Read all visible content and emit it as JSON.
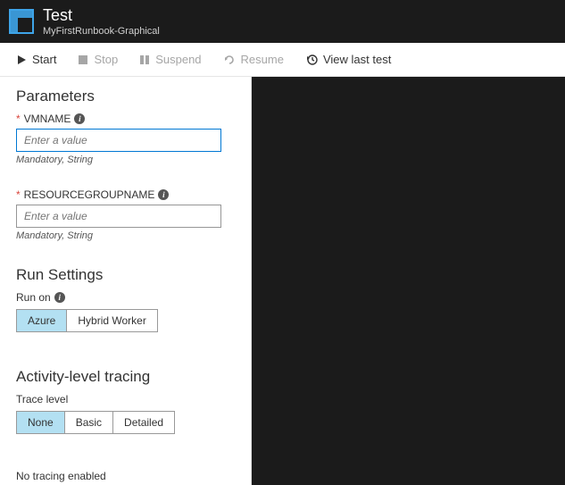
{
  "header": {
    "title": "Test",
    "subtitle": "MyFirstRunbook-Graphical"
  },
  "toolbar": {
    "start": "Start",
    "stop": "Stop",
    "suspend": "Suspend",
    "resume": "Resume",
    "view_last": "View last test"
  },
  "parameters": {
    "title": "Parameters",
    "vmname": {
      "label": "VMNAME",
      "placeholder": "Enter a value",
      "help": "Mandatory, String"
    },
    "rgname": {
      "label": "RESOURCEGROUPNAME",
      "placeholder": "Enter a value",
      "help": "Mandatory, String"
    }
  },
  "run_settings": {
    "title": "Run Settings",
    "label": "Run on",
    "options": {
      "azure": "Azure",
      "hybrid": "Hybrid Worker"
    }
  },
  "tracing": {
    "title": "Activity-level tracing",
    "label": "Trace level",
    "options": {
      "none": "None",
      "basic": "Basic",
      "detailed": "Detailed"
    },
    "message": "No tracing enabled"
  }
}
